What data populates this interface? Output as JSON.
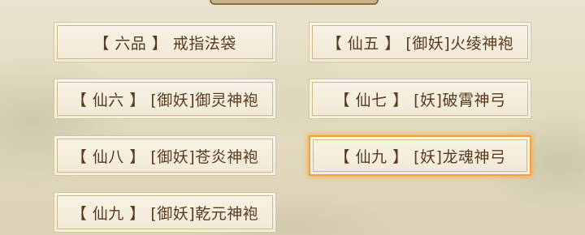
{
  "items": [
    {
      "label": "【 六品 】 戒指法袋",
      "selected": false
    },
    {
      "label": "【 仙五 】 [御妖]火绫神袍",
      "selected": false
    },
    {
      "label": "【 仙六 】 [御妖]御灵神袍",
      "selected": false
    },
    {
      "label": "【 仙七 】 [妖]破霄神弓",
      "selected": false
    },
    {
      "label": "【 仙八 】 [御妖]苍炎神袍",
      "selected": false
    },
    {
      "label": "【 仙九 】 [妖]龙魂神弓",
      "selected": true
    },
    {
      "label": "【 仙九 】 [御妖]乾元神袍",
      "selected": false
    }
  ],
  "colors": {
    "text": "#5a3a1e",
    "selected_glow": "#f0a040",
    "card_background": "#f4eddc"
  }
}
